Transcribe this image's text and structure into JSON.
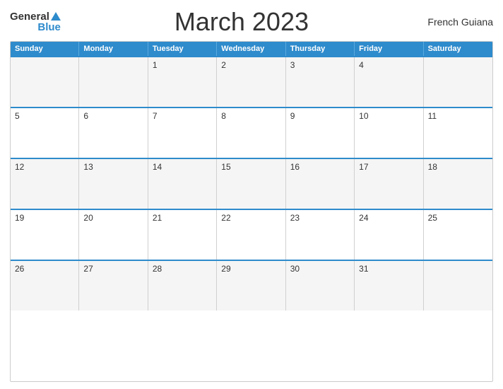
{
  "header": {
    "logo_general": "General",
    "logo_blue": "Blue",
    "title": "March 2023",
    "region": "French Guiana"
  },
  "calendar": {
    "weekdays": [
      "Sunday",
      "Monday",
      "Tuesday",
      "Wednesday",
      "Thursday",
      "Friday",
      "Saturday"
    ],
    "weeks": [
      [
        {
          "day": ""
        },
        {
          "day": ""
        },
        {
          "day": "1"
        },
        {
          "day": "2"
        },
        {
          "day": "3"
        },
        {
          "day": "4"
        },
        {
          "day": ""
        }
      ],
      [
        {
          "day": "5"
        },
        {
          "day": "6"
        },
        {
          "day": "7"
        },
        {
          "day": "8"
        },
        {
          "day": "9"
        },
        {
          "day": "10"
        },
        {
          "day": "11"
        }
      ],
      [
        {
          "day": "12"
        },
        {
          "day": "13"
        },
        {
          "day": "14"
        },
        {
          "day": "15"
        },
        {
          "day": "16"
        },
        {
          "day": "17"
        },
        {
          "day": "18"
        }
      ],
      [
        {
          "day": "19"
        },
        {
          "day": "20"
        },
        {
          "day": "21"
        },
        {
          "day": "22"
        },
        {
          "day": "23"
        },
        {
          "day": "24"
        },
        {
          "day": "25"
        }
      ],
      [
        {
          "day": "26"
        },
        {
          "day": "27"
        },
        {
          "day": "28"
        },
        {
          "day": "29"
        },
        {
          "day": "30"
        },
        {
          "day": "31"
        },
        {
          "day": ""
        }
      ]
    ]
  }
}
